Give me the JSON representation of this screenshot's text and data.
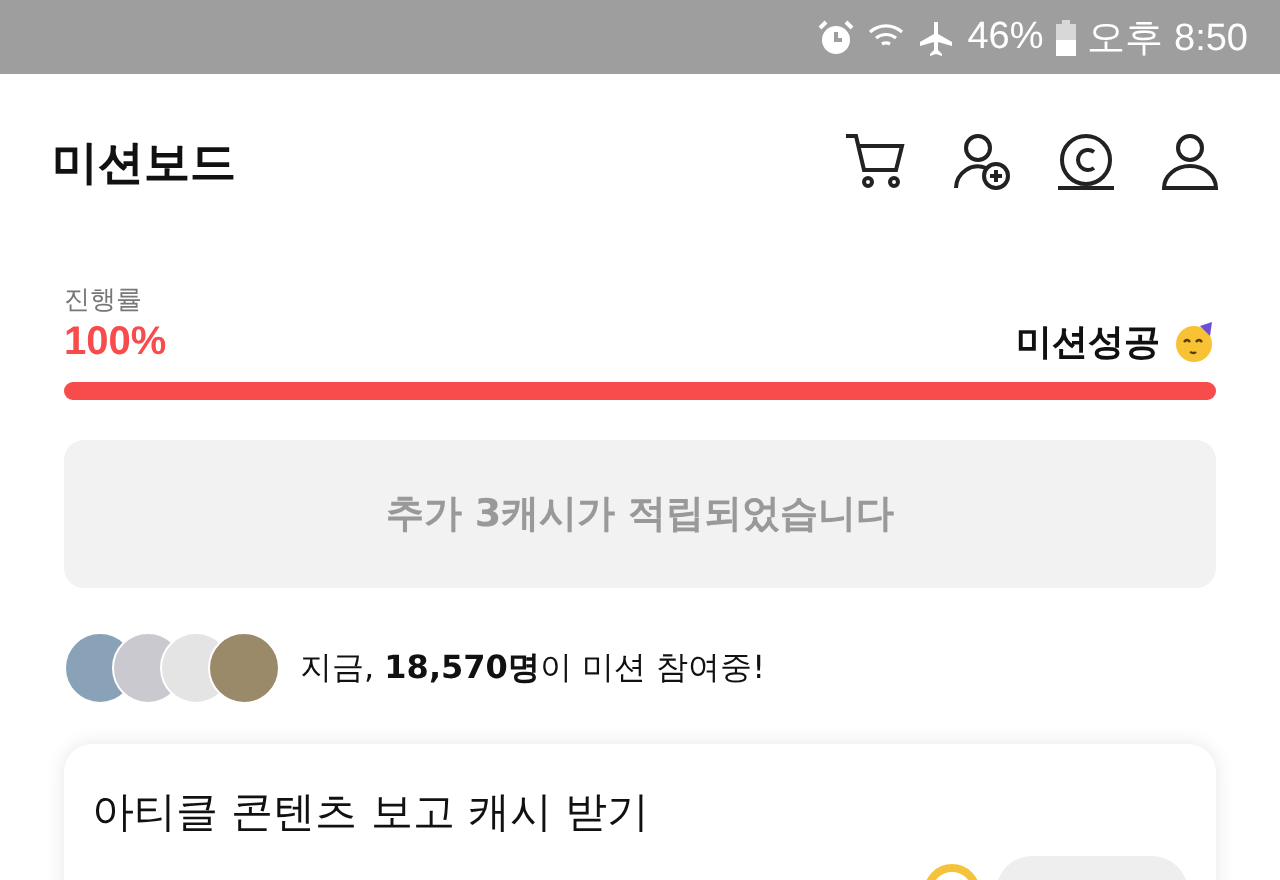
{
  "status_bar": {
    "battery_percent": "46%",
    "time": "오후 8:50"
  },
  "header": {
    "title": "미션보드"
  },
  "progress": {
    "label": "진행률",
    "percent": "100%",
    "level": 1,
    "result": "미션성공"
  },
  "notice": "추가 3캐시가 적립되었습니다",
  "participants": {
    "text": "지금, **18,570명**이 미션 참여중!"
  },
  "mission_card": {
    "title": "아티클 콘텐츠 보고 캐시 받기"
  }
}
